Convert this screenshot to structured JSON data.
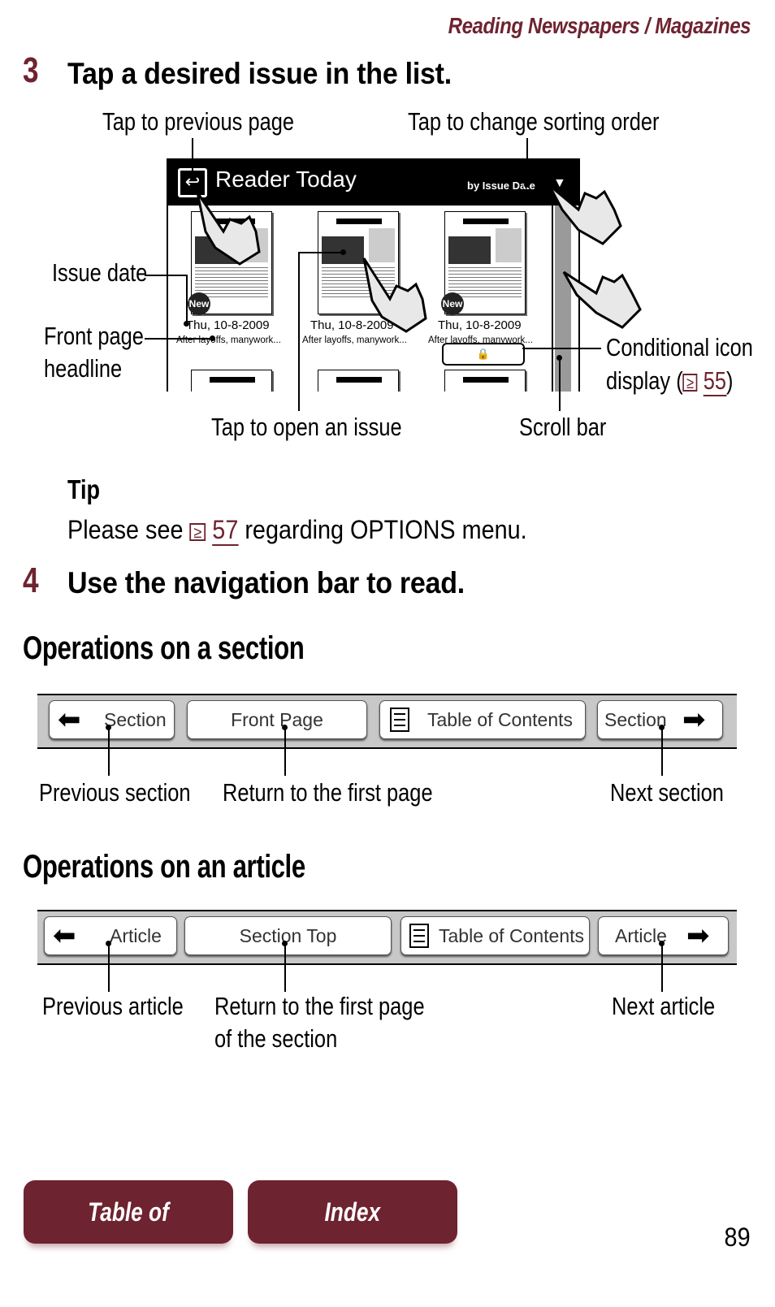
{
  "header": {
    "chapter": "Reading Newspapers / Magazines"
  },
  "step3": {
    "number": "3",
    "title": "Tap a desired issue in the list.",
    "callouts": {
      "previous_page": "Tap to previous page",
      "sorting_order": "Tap to change sorting order",
      "issue_date": "Issue date",
      "front_page_line1": "Front page",
      "front_page_line2": "headline",
      "conditional_line1": "Conditional icon",
      "conditional_line2_pre": "display (",
      "conditional_ref": "55",
      "conditional_line2_post": ")",
      "open_issue": "Tap to open an issue",
      "scroll_bar": "Scroll bar"
    },
    "screen": {
      "title": "Reader Today",
      "sort_label": "by Issue Date",
      "sort_arrow": "▼",
      "back_icon": "↩",
      "issues": [
        {
          "date": "Thu, 10-8-2009",
          "headline": "After layoffs, manywork...",
          "badge": "New"
        },
        {
          "date": "Thu, 10-8-2009",
          "headline": "After layoffs, manywork...",
          "badge": ""
        },
        {
          "date": "Thu, 10-8-2009",
          "headline": "After layoffs, manywork...",
          "badge": "New"
        }
      ],
      "lock_icon": "🔒"
    }
  },
  "tip": {
    "label": "Tip",
    "pre": "Please see ",
    "ref_icon": "≥",
    "ref": "57",
    "post": " regarding OPTIONS menu."
  },
  "step4": {
    "number": "4",
    "title": "Use the navigation bar to read."
  },
  "section_ops": {
    "title": "Operations on a section",
    "buttons": {
      "prev": "Section",
      "first": "Front Page",
      "toc": "Table of Contents",
      "next": "Section"
    },
    "callouts": {
      "prev": "Previous section",
      "first": "Return to the first page",
      "next": "Next section"
    }
  },
  "article_ops": {
    "title": "Operations on an article",
    "buttons": {
      "prev": "Article",
      "first": "Section Top",
      "toc": "Table of Contents",
      "next": "Article"
    },
    "callouts": {
      "prev": "Previous article",
      "first_line1": "Return to the first page",
      "first_line2": "of the section",
      "next": "Next article"
    }
  },
  "footer": {
    "toc": "Table of Contents",
    "index": "Index",
    "page_number": "89"
  },
  "colors": {
    "accent": "#6e2330"
  }
}
